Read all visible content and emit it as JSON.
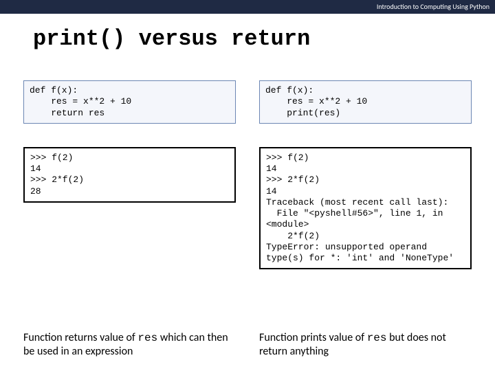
{
  "header": "Introduction to Computing Using Python",
  "title": "print() versus return",
  "left": {
    "code": "def f(x):\n    res = x**2 + 10\n    return res",
    "shell": ">>> f(2)\n14\n>>> 2*f(2)\n28",
    "caption_pre": "Function returns value of ",
    "caption_code": "res",
    "caption_post": " which can then be used in an expression"
  },
  "right": {
    "code": "def f(x):\n    res = x**2 + 10\n    print(res)",
    "shell": ">>> f(2)\n14\n>>> 2*f(2)\n14\nTraceback (most recent call last):\n  File \"<pyshell#56>\", line 1, in <module>\n    2*f(2)\nTypeError: unsupported operand type(s) for *: 'int' and 'NoneType'",
    "caption_pre": "Function prints value of ",
    "caption_code": "res",
    "caption_post": " but does not return anything"
  }
}
